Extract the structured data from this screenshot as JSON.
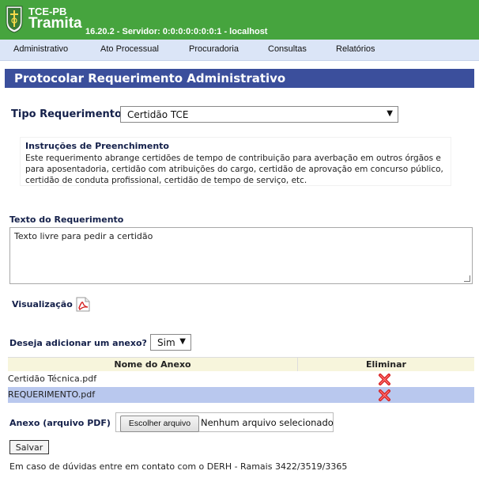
{
  "header": {
    "org": "TCE-PB",
    "app": "Tramita",
    "server": "16.20.2 - Servidor: 0:0:0:0:0:0:0:1 - localhost"
  },
  "menu": [
    "Administrativo",
    "Ato Processual",
    "Procuradoria",
    "Consultas",
    "Relatórios"
  ],
  "page_title": "Protocolar Requerimento Administrativo",
  "tipo": {
    "label": "Tipo Requerimento",
    "value": "Certidão TCE"
  },
  "instructions": {
    "title": "Instruções de Preenchimento",
    "text": "Este requerimento abrange certidões de tempo de contribuição para averbação em outros órgãos e para aposentadoria, certidão com atribuições do cargo, certidão de aprovação em concurso público, certidão de conduta profissional, certidão de tempo de serviço, etc."
  },
  "texto": {
    "label": "Texto do Requerimento",
    "value": "Texto livre para pedir a certidão"
  },
  "visualizacao": "Visualização",
  "anexo_question": {
    "label": "Deseja adicionar um anexo?",
    "value": "Sim"
  },
  "table": {
    "headers": [
      "Nome do Anexo",
      "Eliminar"
    ],
    "rows": [
      {
        "name": "Certidão Técnica.pdf"
      },
      {
        "name": "REQUERIMENTO.pdf"
      }
    ]
  },
  "file": {
    "label": "Anexo (arquivo PDF)",
    "button": "Escolher arquivo",
    "status": "Nenhum arquivo selecionado"
  },
  "save_label": "Salvar",
  "footer": "Em caso de dúvidas entre em contato com o DERH - Ramais 3422/3519/3365",
  "colors": {
    "header_green": "#46a43e",
    "menu_bg": "#dbe5f7",
    "title_bar": "#3b4f9c",
    "selected_row": "#b9c8ee",
    "table_header": "#f7f5dc"
  }
}
